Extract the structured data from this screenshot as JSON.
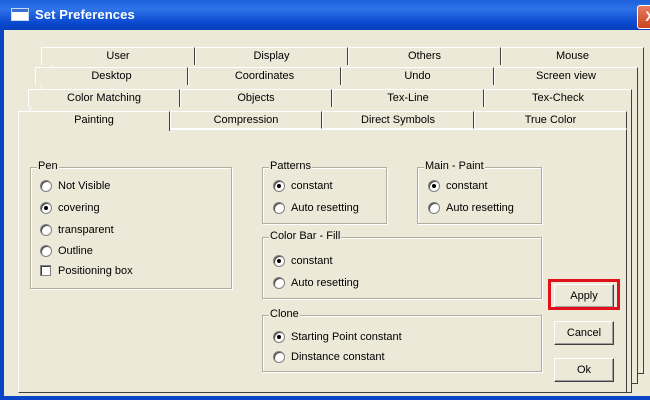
{
  "window": {
    "title": "Set Preferences",
    "close_label": "X"
  },
  "tabs": {
    "row1": [
      "User",
      "Display",
      "Others",
      "Mouse"
    ],
    "row2": [
      "Desktop",
      "Coordinates",
      "Undo",
      "Screen view"
    ],
    "row3": [
      "Color Matching",
      "Objects",
      "Tex-Line",
      "Tex-Check"
    ],
    "row4": [
      "Painting",
      "Compression",
      "Direct Symbols",
      "True Color"
    ],
    "active": "Painting"
  },
  "pen": {
    "legend": "Pen",
    "options": [
      "Not Visible",
      "covering",
      "transparent",
      "Outline"
    ],
    "selected": "covering",
    "checkbox_label": "Positioning box",
    "checkbox_checked": false
  },
  "patterns": {
    "legend": "Patterns",
    "options": [
      "constant",
      "Auto resetting"
    ],
    "selected": "constant"
  },
  "main_paint": {
    "legend": "Main - Paint",
    "options": [
      "constant",
      "Auto resetting"
    ],
    "selected": "constant"
  },
  "color_bar_fill": {
    "legend": "Color Bar - Fill",
    "options": [
      "constant",
      "Auto resetting"
    ],
    "selected": "constant"
  },
  "clone": {
    "legend": "Clone",
    "options": [
      "Starting Point constant",
      "Dinstance constant"
    ],
    "selected": "Starting Point constant"
  },
  "buttons": {
    "apply": "Apply",
    "cancel": "Cancel",
    "ok": "Ok"
  },
  "colors": {
    "highlight": "#e0101a",
    "titlebar": "#0a4ad0",
    "dialog_bg": "#ece9d8"
  }
}
